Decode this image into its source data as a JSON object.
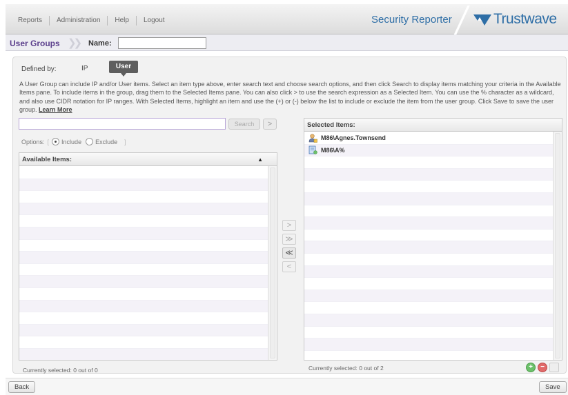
{
  "header": {
    "menu": [
      "Reports",
      "Administration",
      "Help",
      "Logout"
    ],
    "product": "Security Reporter",
    "brand": "Trustwave",
    "brand_color": "#2e6ea6"
  },
  "breadcrumb": {
    "title": "User Groups",
    "name_label": "Name:",
    "name_value": ""
  },
  "defined_by": {
    "label": "Defined by:",
    "options": [
      "IP",
      "User"
    ],
    "selected": "User"
  },
  "instructions": {
    "text": "A User Group can include IP and/or User items. Select an item type above, enter search text and choose search options, and then click Search to display items matching your criteria in the Available Items pane. To include items in the group, drag them to the Selected Items pane. You can also click > to use the search expression as a Selected Item. You can use the % character as a wildcard, and also use CIDR notation for IP ranges. With Selected Items, highlight an item and use the (+) or (-) below the list to include or exclude the item from the user group. Click Save to save the user group.",
    "learn_more": "Learn More"
  },
  "search": {
    "value": "",
    "button": "Search",
    "use_expression": ">"
  },
  "options": {
    "label": "Options:",
    "include": "Include",
    "exclude": "Exclude",
    "selected": "Include"
  },
  "available": {
    "header": "Available Items:",
    "sort_icon": "▲",
    "status": "Currently selected: 0 out of 0"
  },
  "selected": {
    "header": "Selected Items:",
    "items": [
      {
        "label": "M86\\Agnes.Townsend",
        "icon": "user-icon"
      },
      {
        "label": "M86\\A%",
        "icon": "wildcard-icon"
      }
    ],
    "status": "Currently selected: 0 out of 2"
  },
  "transfer": {
    "move_right": ">",
    "move_all_right": "≫",
    "move_all_left": "≪",
    "move_left": "<"
  },
  "footer": {
    "back": "Back",
    "save": "Save"
  }
}
